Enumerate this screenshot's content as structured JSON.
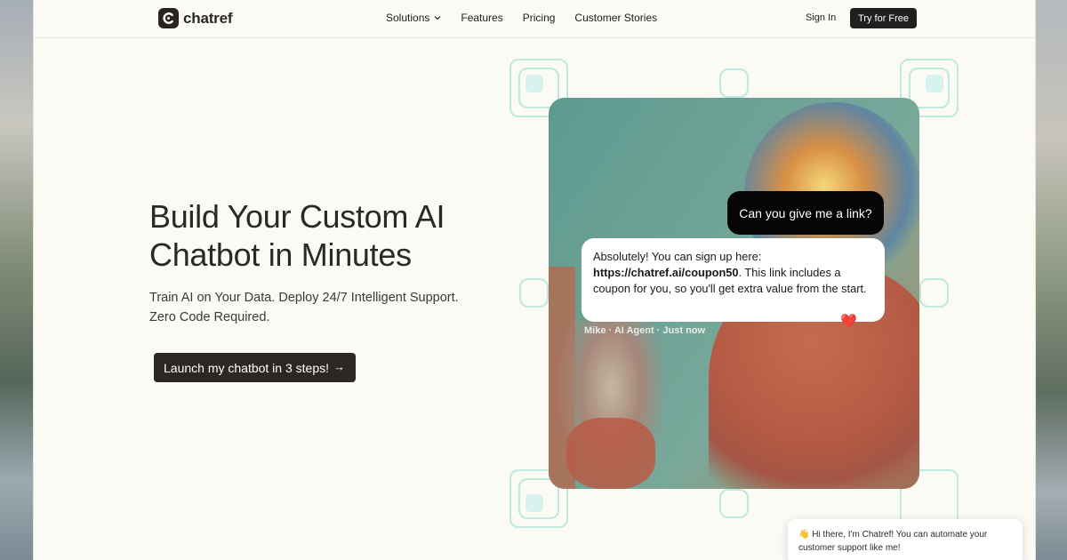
{
  "brand": {
    "name": "chatref"
  },
  "nav": {
    "items": [
      {
        "label": "Solutions",
        "has_dropdown": true
      },
      {
        "label": "Features"
      },
      {
        "label": "Pricing"
      },
      {
        "label": "Customer Stories"
      }
    ],
    "signin_label": "Sign In",
    "cta_label": "Try for Free"
  },
  "hero": {
    "title": "Build Your Custom AI Chatbot in Minutes",
    "subtitle": "Train AI on Your Data. Deploy 24/7 Intelligent Support. Zero Code Required.",
    "cta_label": "Launch my chatbot in 3 steps!",
    "cta_icon": "arrow-right-icon"
  },
  "chat_demo": {
    "user_message": "Can you give me a link?",
    "agent_message_prefix": "Absolutely! You can sign up here: ",
    "agent_link": "https://chatref.ai/coupon50",
    "agent_message_suffix": ". This link includes a coupon for you, so you'll get extra value from the start.",
    "reaction": "❤️",
    "meta": "Mike · AI Agent · Just now"
  },
  "widget": {
    "greeting": "👋 Hi there, I'm Chatref! You can automate your customer support like me!"
  },
  "colors": {
    "page_bg": "#fbfaf4",
    "primary_dark": "#22201e",
    "deco_mint": "#bfe8e1"
  }
}
